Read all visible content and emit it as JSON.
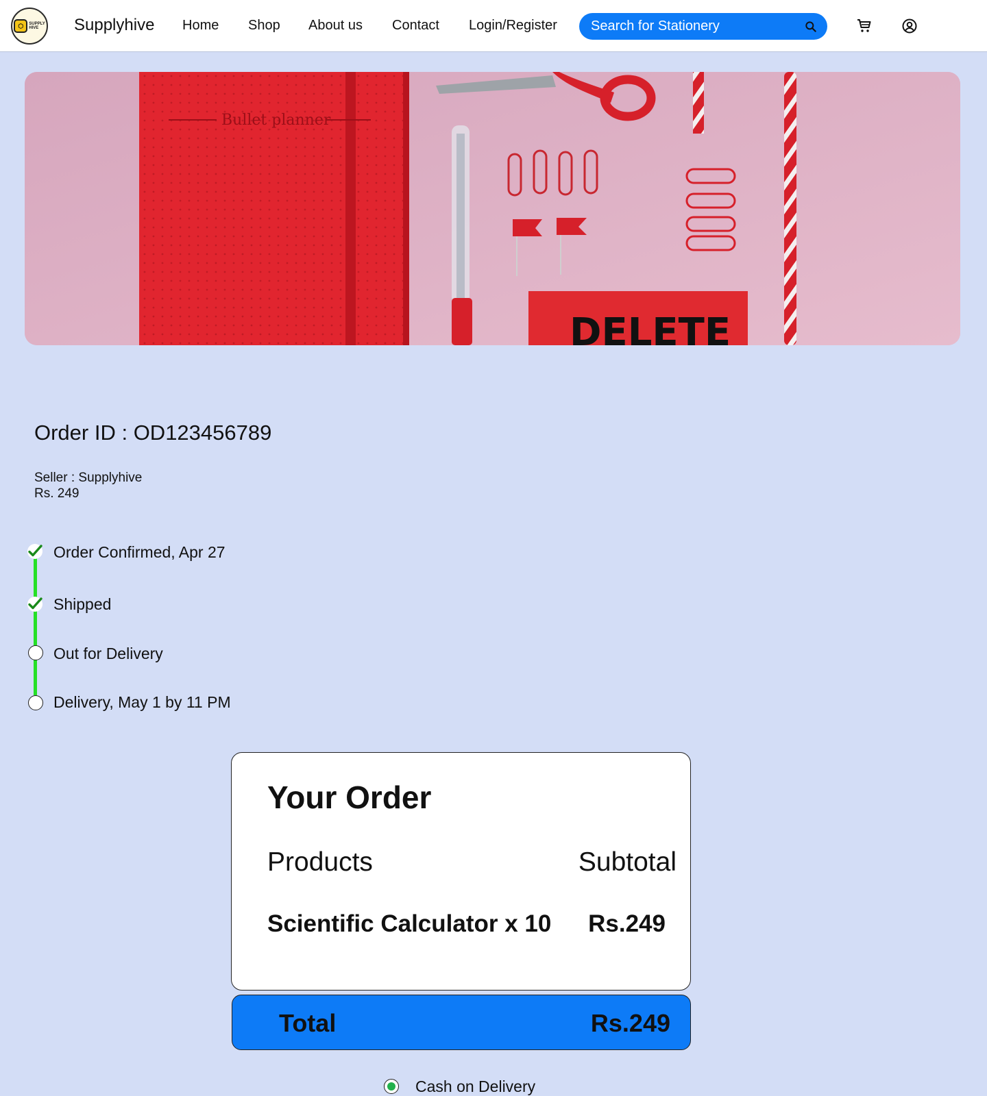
{
  "nav": {
    "logo_text_top": "SUPPLY",
    "logo_text_bottom": "HIVE",
    "brand": "Supplyhive",
    "links": [
      "Home",
      "Shop",
      "About us",
      "Contact",
      "Login/Register"
    ],
    "search_placeholder": "Search for Stationery",
    "icons": [
      "search-icon",
      "cart-icon",
      "account-icon"
    ]
  },
  "hero": {
    "planner_text": "Bullet planner",
    "eraser_text": "DELETE"
  },
  "order": {
    "id_line": "Order ID : OD123456789",
    "seller_line": "Seller : Supplyhive",
    "price_line": "Rs. 249"
  },
  "tracker": {
    "steps": [
      {
        "label": "Order Confirmed, Apr 27",
        "done": true
      },
      {
        "label": "Shipped",
        "done": true
      },
      {
        "label": "Out for Delivery",
        "done": false
      },
      {
        "label": "Delivery, May 1 by 11 PM",
        "done": false
      }
    ],
    "line_color": "#26e026",
    "check_color": "#1a8a1a"
  },
  "summary": {
    "title": "Your Order",
    "col_products": "Products",
    "col_subtotal": "Subtotal",
    "item_name": "Scientific Calculator x 10",
    "item_price": "Rs.249",
    "total_label": "Total",
    "total_value": "Rs.249"
  },
  "payment": {
    "option_label": "Cash on Delivery",
    "selected": true
  },
  "colors": {
    "page_bg": "#d3ddf6",
    "accent": "#0d7bf7"
  }
}
